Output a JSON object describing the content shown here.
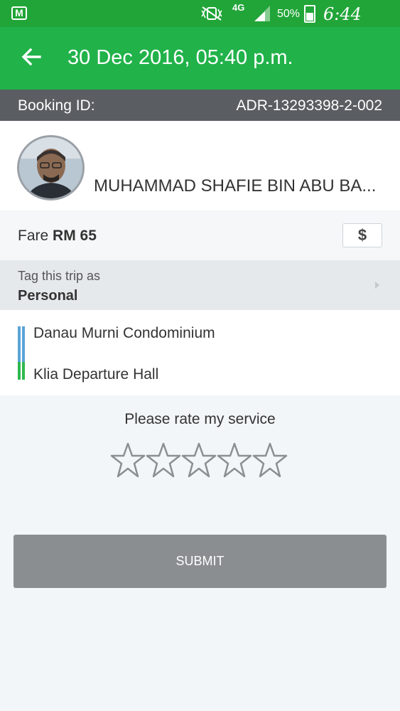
{
  "status_bar": {
    "notification_icon": "gmail-icon",
    "notification_letter": "M",
    "network": "4G",
    "battery_percent": "50%",
    "time": "6:44 p.m."
  },
  "app_bar": {
    "back_icon": "arrow-left-icon",
    "title": "30 Dec 2016, 05:40 p.m."
  },
  "booking": {
    "label": "Booking ID:",
    "id": "ADR-13293398-2-002"
  },
  "driver": {
    "name": "MUHAMMAD SHAFIE BIN ABU BA..."
  },
  "fare": {
    "label": "Fare",
    "amount": "RM 65",
    "button_glyph": "$"
  },
  "tag": {
    "label": "Tag this trip as",
    "value": "Personal"
  },
  "route": {
    "pickup": "Danau Murni Condominium",
    "dropoff": "Klia Departure Hall",
    "pickup_color": "#5aa4d8",
    "dropoff_color": "#2db84d"
  },
  "rating": {
    "label": "Please rate my service",
    "stars_total": 5,
    "stars_selected": 0
  },
  "submit_label": "SUBMIT",
  "colors": {
    "status_bar": "#21a538",
    "app_bar": "#21b24a",
    "booking_bar": "#5a5d62",
    "submit_disabled": "#8b8e91"
  }
}
